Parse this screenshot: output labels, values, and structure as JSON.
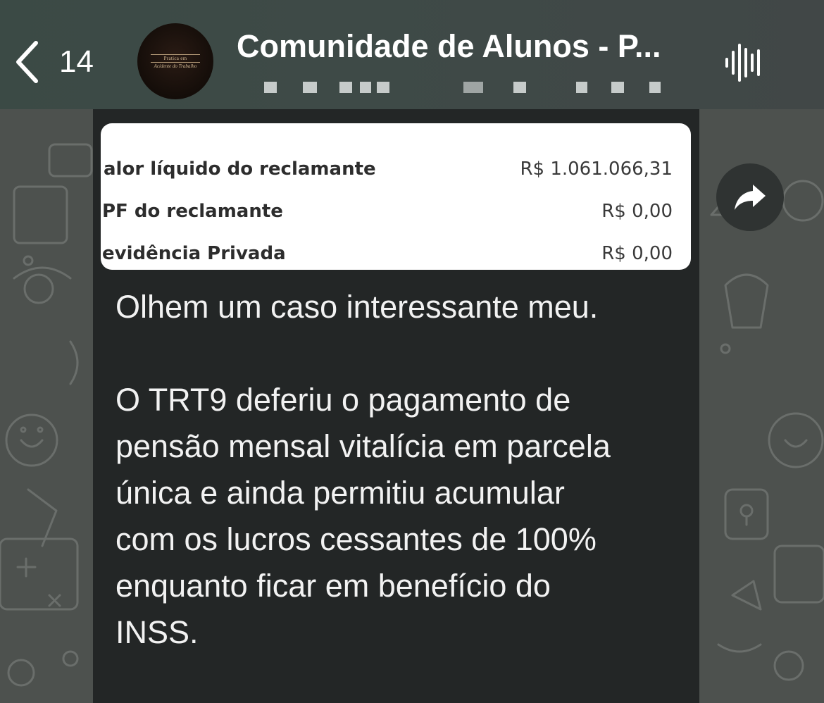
{
  "header": {
    "back_count": "14",
    "chat_title": "Comunidade de Alunos - P...",
    "avatar_text_top": "Pratica em",
    "avatar_text_bottom": "Acidente do Trabalho",
    "icons": {
      "back": "chevron-left-icon",
      "voice": "voice-waveform-icon"
    }
  },
  "message": {
    "attachment_rows": [
      {
        "label": "alor líquido do reclamante",
        "value": "R$ 1.061.066,31"
      },
      {
        "label": "PF do reclamante",
        "value": "R$ 0,00"
      },
      {
        "label": "evidência Privada",
        "value": "R$ 0,00"
      }
    ],
    "text": "Olhem um caso interessante meu.\n\nO TRT9 deferiu o pagamento de\npensão mensal vitalícia em parcela\núnica e ainda permitiu acumular\ncom os lucros cessantes de 100%\nenquanto ficar em benefício do\nINSS.",
    "forward_icon": "forward-arrow-icon"
  },
  "colors": {
    "header_bg": "#3e4a47",
    "bubble_bg": "#232626",
    "wallpaper_bg": "#4d514e",
    "text_primary": "#f2f2f2"
  }
}
